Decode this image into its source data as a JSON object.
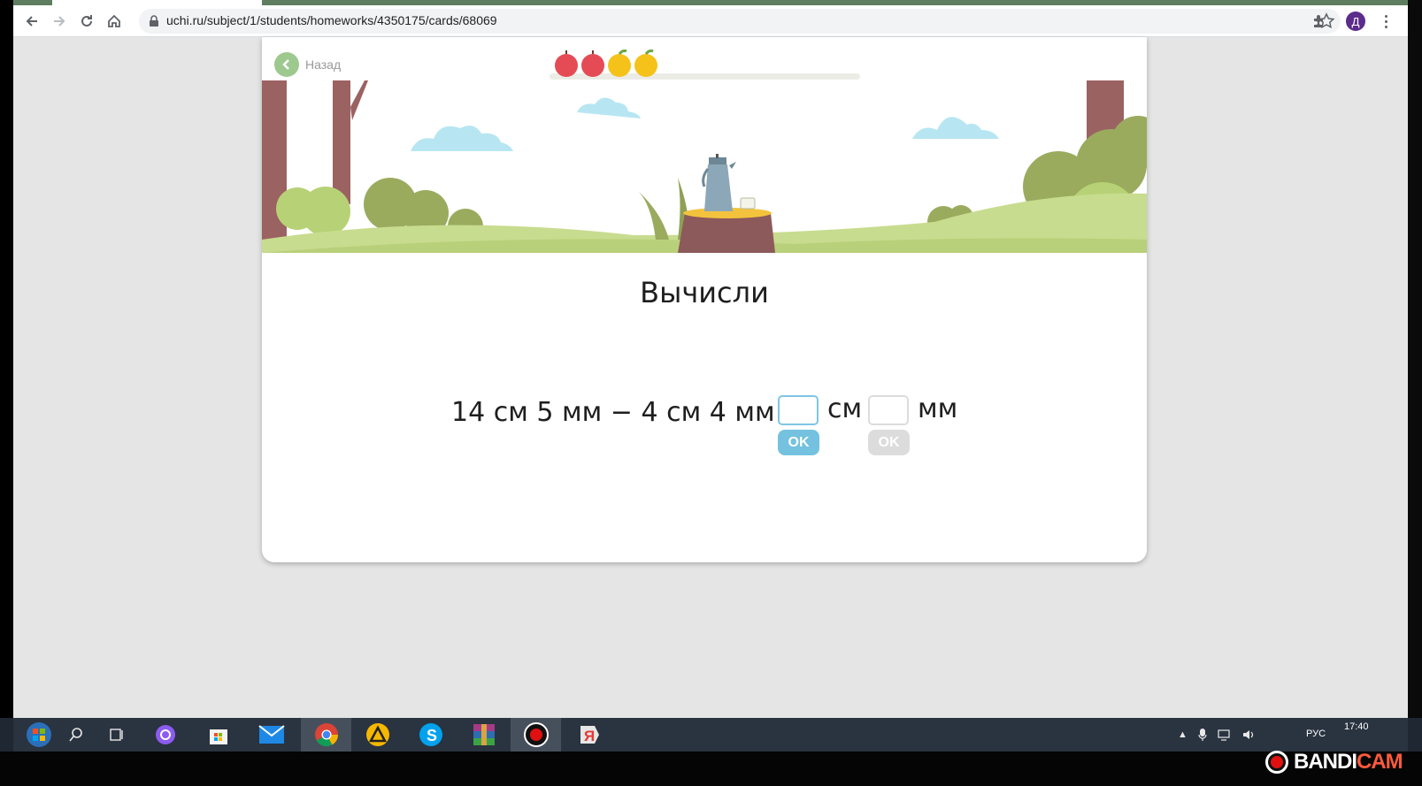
{
  "browser": {
    "url": "uchi.ru/subject/1/students/homeworks/4350175/cards/68069",
    "profile_initial": "Д"
  },
  "page": {
    "back_label": "Назад",
    "progress": {
      "fruits_total": 4,
      "red_apples": 2,
      "yellow_apples": 2
    },
    "title": "Вычисли",
    "equation": "14 см 5 мм − 4 см 4 мм =",
    "unit_cm": "см",
    "unit_mm": "мм",
    "ok_cm": "OK",
    "ok_mm": "OK"
  },
  "taskbar": {
    "lang": "РУС",
    "time": "17:40",
    "watermark_left": "BANDI",
    "watermark_right": "CAM",
    "icons": [
      "windows-start-icon",
      "search-icon",
      "task-view-icon",
      "alice-icon",
      "store-icon",
      "mail-icon",
      "chrome-icon",
      "arrow-icon",
      "skype-icon",
      "winrar-icon",
      "record-icon",
      "yandex-icon"
    ]
  },
  "colors": {
    "ok_active": "#74c2e0",
    "ok_disabled": "#dcdcdc",
    "input_active_border": "#7fc5e6",
    "back_button": "#9dc98e",
    "tabstrip": "#5f7e5f"
  }
}
